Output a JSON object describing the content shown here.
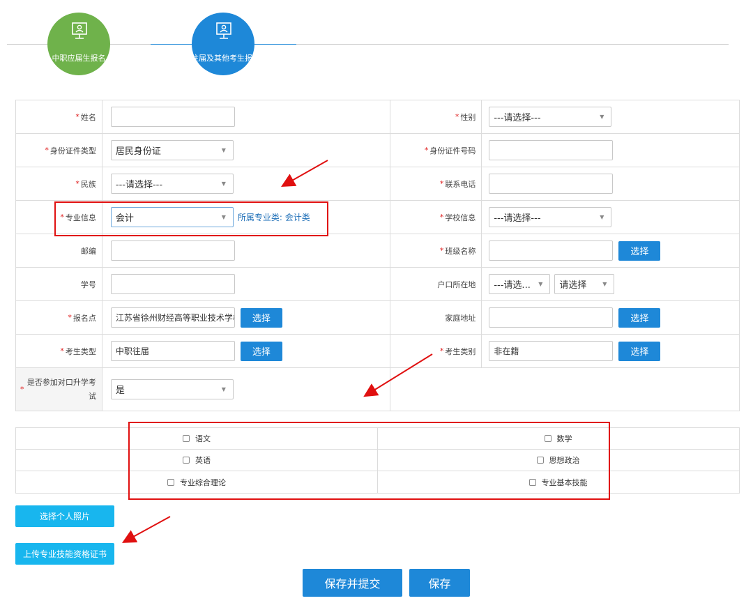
{
  "steps": [
    {
      "label": "中职应届生报名"
    },
    {
      "label": "往届及其他考生报"
    }
  ],
  "form": {
    "name_label": "姓名",
    "gender_label": "性别",
    "gender_value": "---请选择---",
    "id_type_label": "身份证件类型",
    "id_type_value": "居民身份证",
    "id_number_label": "身份证件号码",
    "ethnicity_label": "民族",
    "ethnicity_value": "---请选择---",
    "phone_label": "联系电话",
    "major_label": "专业信息",
    "major_value": "会计",
    "major_hint": "所属专业类: 会计类",
    "school_label": "学校信息",
    "school_value": "---请选择---",
    "postcode_label": "邮编",
    "class_label": "班级名称",
    "student_no_label": "学号",
    "hukou_label": "户口所在地",
    "hukou_value1": "---请选...",
    "hukou_value2": "请选择",
    "signup_point_label": "报名点",
    "signup_point_value": "江苏省徐州财经高等职业技术学校",
    "home_address_label": "家庭地址",
    "examinee_type_label": "考生类型",
    "examinee_type_value": "中职往届",
    "examinee_category_label": "考生类别",
    "examinee_category_value": "非在籍",
    "counterpart_label": "是否参加对口升学考试",
    "counterpart_value": "是",
    "select_btn": "选择"
  },
  "subjects": [
    {
      "left": "语文",
      "right": "数学"
    },
    {
      "left": "英语",
      "right": "思想政治"
    },
    {
      "left": "专业综合理论",
      "right": "专业基本技能"
    }
  ],
  "buttons": {
    "select_photo": "选择个人照片",
    "upload_cert": "上传专业技能资格证书",
    "save_submit": "保存并提交",
    "save": "保存"
  },
  "colors": {
    "primary": "#1e88d8",
    "cyan": "#18b6ee",
    "green_step": "#6fb24b",
    "required": "#e02020",
    "annotation_red": "#e01010"
  }
}
